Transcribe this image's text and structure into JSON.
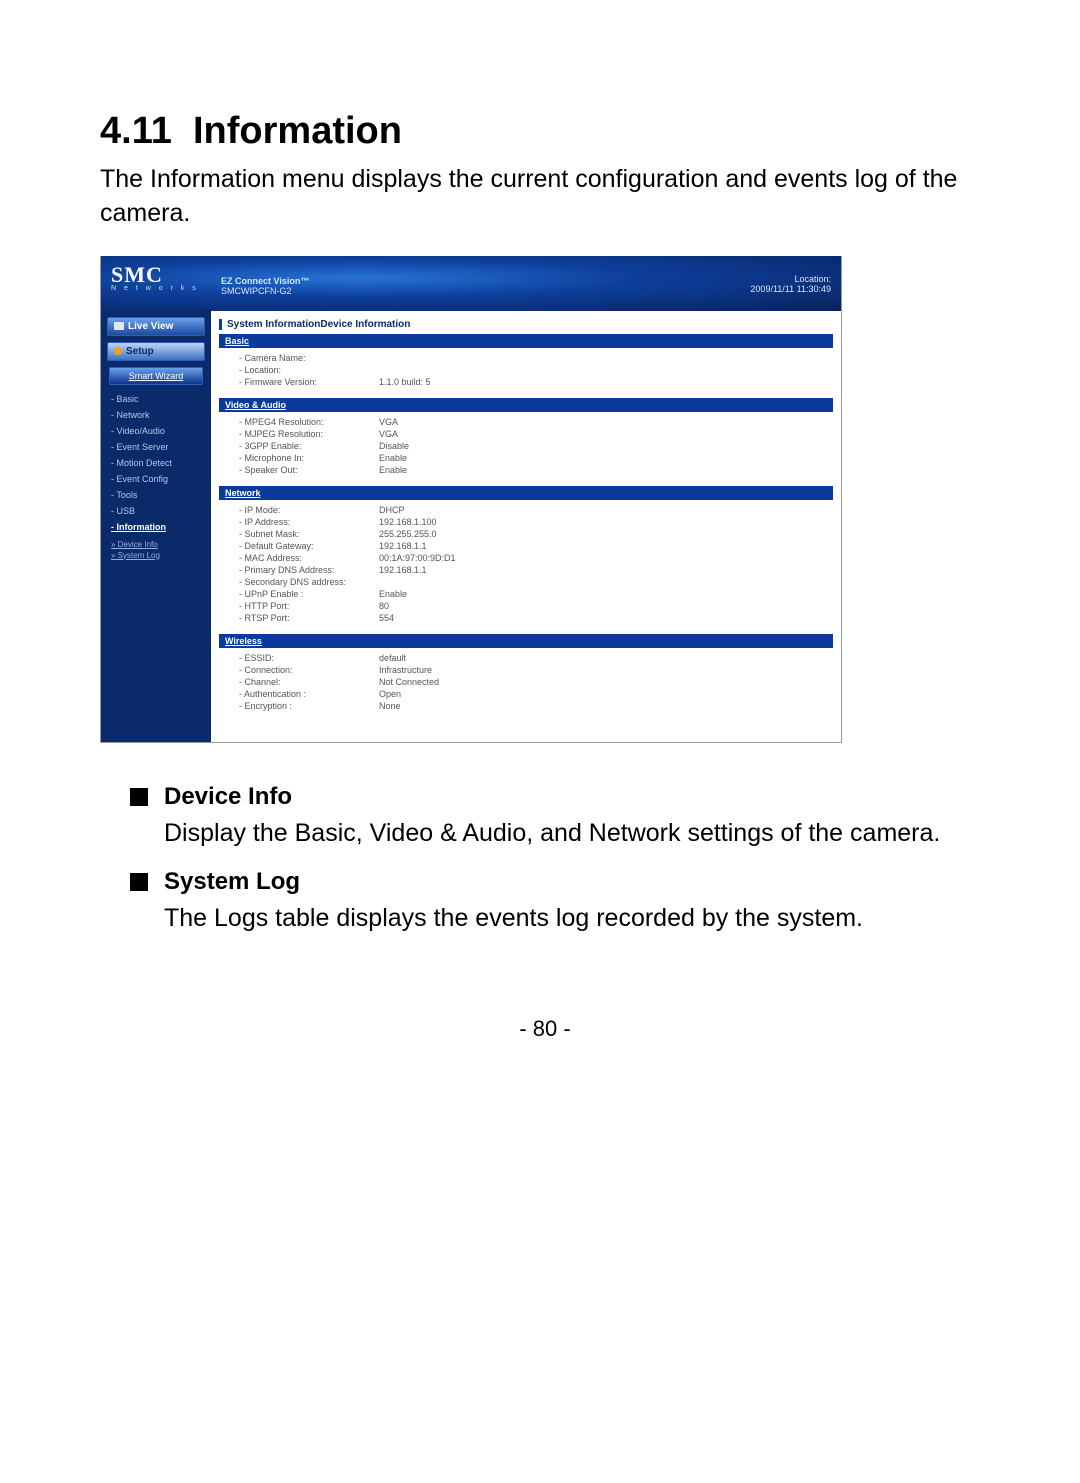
{
  "doc": {
    "section_number": "4.11",
    "section_title": "Information",
    "intro": "The Information menu displays the current configuration and events log of the camera.",
    "device_info_title": "Device Info",
    "device_info_text": "Display the Basic, Video & Audio, and Network settings of the camera.",
    "system_log_title": "System Log",
    "system_log_text": "The Logs table displays the events log recorded by the system.",
    "page_number": "- 80 -"
  },
  "ui": {
    "logo_main": "SMC",
    "logo_sub": "N e t w o r k s",
    "header_line1": "EZ Connect Vision™",
    "header_line2": "SMCWIPCFN-G2",
    "header_loc_label": "Location:",
    "header_loc_time": "2009/11/11 11:30:49",
    "btn_live_view": "Live View",
    "btn_setup": "Setup",
    "btn_smart_wizard": "Smart Wizard",
    "nav": {
      "basic": "Basic",
      "network": "Network",
      "video_audio": "Video/Audio",
      "event_server": "Event Server",
      "motion_detect": "Motion Detect",
      "event_config": "Event Config",
      "tools": "Tools",
      "usb": "USB",
      "information": "Information",
      "device_info": "Device Info",
      "system_log": "System Log"
    },
    "breadcrumb": "System InformationDevice Information",
    "sections": {
      "basic": {
        "title": "Basic",
        "camera_name_k": "Camera Name:",
        "camera_name_v": "",
        "location_k": "Location:",
        "location_v": "",
        "firmware_k": "Firmware Version:",
        "firmware_v": "1.1.0 build: 5"
      },
      "va": {
        "title": "Video & Audio",
        "mpeg4_k": "MPEG4 Resolution:",
        "mpeg4_v": "VGA",
        "mjpeg_k": "MJPEG Resolution:",
        "mjpeg_v": "VGA",
        "gpp_k": "3GPP Enable:",
        "gpp_v": "Disable",
        "mic_k": "Microphone In:",
        "mic_v": "Enable",
        "spk_k": "Speaker Out:",
        "spk_v": "Enable"
      },
      "net": {
        "title": "Network",
        "ipmode_k": "IP Mode:",
        "ipmode_v": "DHCP",
        "ip_k": "IP Address:",
        "ip_v": "192.168.1.100",
        "mask_k": "Subnet Mask:",
        "mask_v": "255.255.255.0",
        "gw_k": "Default Gateway:",
        "gw_v": "192.168.1.1",
        "mac_k": "MAC Address:",
        "mac_v": "00:1A:97:00:9D:D1",
        "dns1_k": "Primary DNS Address:",
        "dns1_v": "192.168.1.1",
        "dns2_k": "Secondary DNS address:",
        "dns2_v": "",
        "upnp_k": "UPnP Enable :",
        "upnp_v": "Enable",
        "http_k": "HTTP Port:",
        "http_v": "80",
        "rtsp_k": "RTSP Port:",
        "rtsp_v": "554"
      },
      "wl": {
        "title": "Wireless",
        "essid_k": "ESSID:",
        "essid_v": "default",
        "conn_k": "Connection:",
        "conn_v": "Infrastructure",
        "chan_k": "Channel:",
        "chan_v": "Not Connected",
        "auth_k": "Authentication :",
        "auth_v": "Open",
        "enc_k": "Encryption :",
        "enc_v": "None"
      }
    }
  }
}
